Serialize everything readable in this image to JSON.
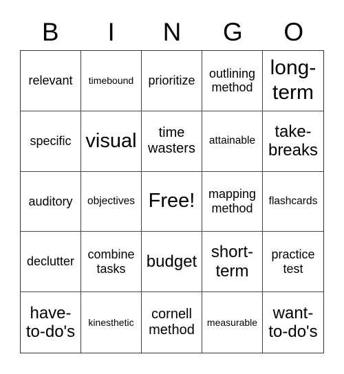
{
  "card": {
    "header": [
      "B",
      "I",
      "N",
      "G",
      "O"
    ],
    "rows": [
      [
        "relevant",
        "timebound",
        "prioritize",
        "outlining method",
        "long-term"
      ],
      [
        "specific",
        "visual",
        "time wasters",
        "attainable",
        "take-breaks"
      ],
      [
        "auditory",
        "objectives",
        "Free!",
        "mapping method",
        "flashcards"
      ],
      [
        "declutter",
        "combine tasks",
        "budget",
        "short-term",
        "practice test"
      ],
      [
        "have-to-do's",
        "kinesthetic",
        "cornell method",
        "measurable",
        "want-to-do's"
      ]
    ],
    "free_space": "Free!"
  }
}
